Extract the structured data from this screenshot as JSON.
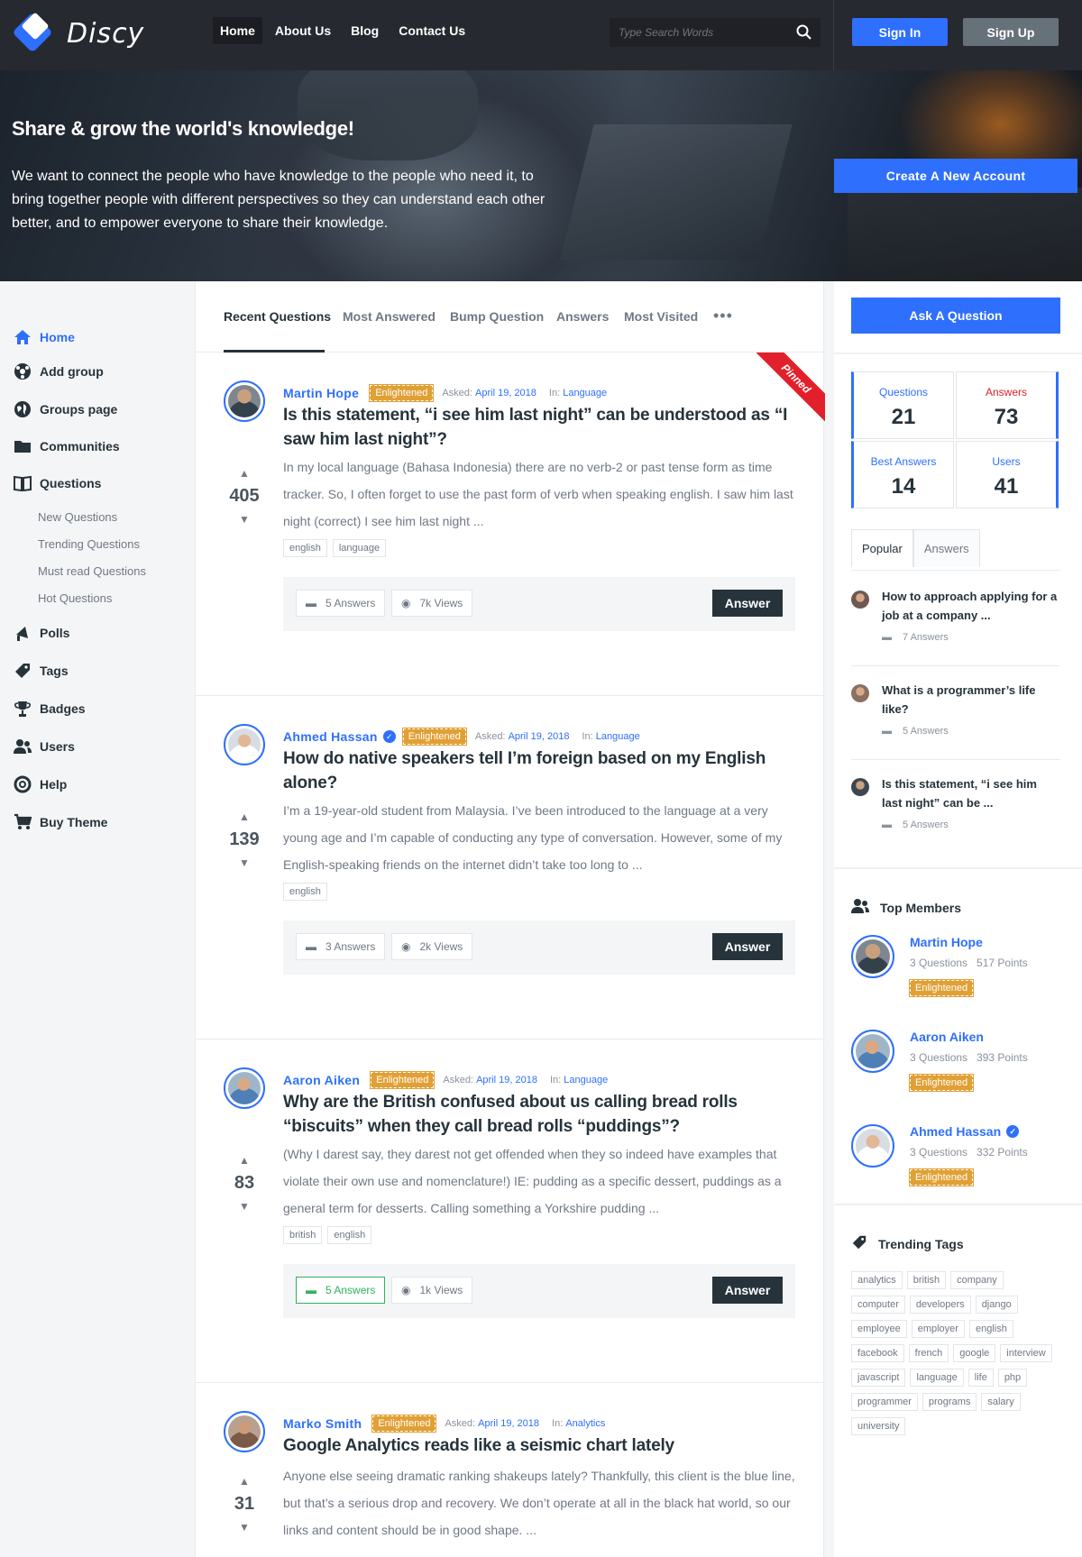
{
  "brand": {
    "name": "Discy"
  },
  "nav": {
    "items": [
      "Home",
      "About Us",
      "Blog",
      "Contact Us"
    ]
  },
  "search": {
    "placeholder": "Type Search Words"
  },
  "auth": {
    "sign_in": "Sign In",
    "sign_up": "Sign Up"
  },
  "hero": {
    "title": "Share & grow the world's knowledge!",
    "text": "We want to connect the people who have knowledge to the people who need it, to bring together people with different perspectives so they can understand each other better, and to empower everyone to share their knowledge.",
    "cta": "Create A New Account"
  },
  "sidebar_left": {
    "items": [
      "Home",
      "Add group",
      "Groups page",
      "Communities",
      "Questions",
      "Polls",
      "Tags",
      "Badges",
      "Users",
      "Help",
      "Buy Theme"
    ],
    "sub_items": [
      "New Questions",
      "Trending Questions",
      "Must read Questions",
      "Hot Questions"
    ]
  },
  "tabs": [
    "Recent Questions",
    "Most Answered",
    "Bump Question",
    "Answers",
    "Most Visited"
  ],
  "labels": {
    "asked": "Asked:",
    "in": "In:",
    "pinned": "Pinned",
    "answer": "Answer"
  },
  "questions": [
    {
      "author": "Martin Hope",
      "badge": "Enlightened",
      "date": "April 19, 2018",
      "category": "Language",
      "title": "Is this statement, “i see him last night” can be understood as “I saw him last night”?",
      "votes": "405",
      "excerpt": "In my local language (Bahasa Indonesia) there are no verb-2 or past tense form as time tracker. So, I often forget to use the past form of verb when speaking english. I saw him last night (correct) I see him last night ...",
      "tags": [
        "english",
        "language"
      ],
      "answers": "5 Answers",
      "views": "7k Views"
    },
    {
      "author": "Ahmed Hassan",
      "badge": "Enlightened",
      "date": "April 19, 2018",
      "category": "Language",
      "title": "How do native speakers tell I’m foreign based on my English alone?",
      "votes": "139",
      "excerpt": "I’m a 19-year-old student from Malaysia. I’ve been introduced to the language at a very young age and I’m capable of conducting any type of conversation. However, some of my English-speaking friends on the internet didn’t take too long to ...",
      "tags": [
        "english"
      ],
      "answers": "3 Answers",
      "views": "2k Views"
    },
    {
      "author": "Aaron Aiken",
      "badge": "Enlightened",
      "date": "April 19, 2018",
      "category": "Language",
      "title": "Why are the British confused about us calling bread rolls “biscuits” when they call bread rolls “puddings”?",
      "votes": "83",
      "excerpt": "(Why I darest say, they darest not get offended when they so indeed have examples that violate their own use and nomenclature!) IE: pudding as a specific dessert, puddings as a general term for desserts. Calling something a Yorkshire pudding ...",
      "tags": [
        "british",
        "english"
      ],
      "answers": "5 Answers",
      "views": "1k Views"
    },
    {
      "author": "Marko Smith",
      "badge": "Enlightened",
      "date": "April 19, 2018",
      "category": "Analytics",
      "title": "Google Analytics reads like a seismic chart lately",
      "votes": "31",
      "excerpt": "Anyone else seeing dramatic ranking shakeups lately? Thankfully, this client is the blue line, but that’s a serious drop and recovery. We don’t operate at all in the black hat world, so our links and content should be in good shape. ..."
    }
  ],
  "sidebar_right": {
    "ask": "Ask A Question",
    "stats": [
      {
        "label": "Questions",
        "value": "21",
        "color": "#2e6ffd"
      },
      {
        "label": "Answers",
        "value": "73",
        "color": "#e2202b"
      },
      {
        "label": "Best Answers",
        "value": "14",
        "color": "#2e6ffd"
      },
      {
        "label": "Users",
        "value": "41",
        "color": "#2e6ffd"
      }
    ],
    "tabs": [
      "Popular",
      "Answers"
    ],
    "popular": [
      {
        "title": "How to approach applying for a job at a company ...",
        "answers": "7 Answers"
      },
      {
        "title": "What is a programmer’s life like?",
        "answers": "5 Answers"
      },
      {
        "title": "Is this statement, “i see him last night” can be ...",
        "answers": "5 Answers"
      }
    ],
    "top_members_title": "Top Members",
    "members": [
      {
        "name": "Martin Hope",
        "questions": "3 Questions",
        "points": "517 Points",
        "badge": "Enlightened"
      },
      {
        "name": "Aaron Aiken",
        "questions": "3 Questions",
        "points": "393 Points",
        "badge": "Enlightened"
      },
      {
        "name": "Ahmed Hassan",
        "questions": "3 Questions",
        "points": "332 Points",
        "badge": "Enlightened"
      }
    ],
    "trending_title": "Trending Tags",
    "tags": [
      "analytics",
      "british",
      "company",
      "computer",
      "developers",
      "django",
      "employee",
      "employer",
      "english",
      "facebook",
      "french",
      "google",
      "interview",
      "javascript",
      "language",
      "life",
      "php",
      "programmer",
      "programs",
      "salary",
      "university"
    ]
  },
  "colors": {
    "accent": "#2e6ffd",
    "dark": "#26333b",
    "badge": "#e1a035",
    "pinned": "#e2202b",
    "answered": "#2fb15d"
  }
}
